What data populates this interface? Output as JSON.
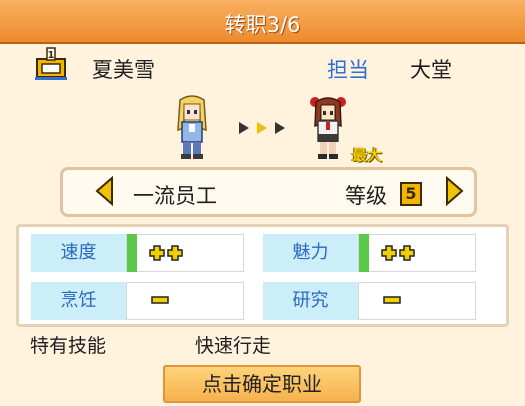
{
  "title": "转职3/6",
  "employee": {
    "name": "夏美雪",
    "rank_icon": "rank-1-icon",
    "role_label": "担当",
    "department": "大堂"
  },
  "transition": {
    "from_sprite": "blonde-employee-sprite",
    "to_sprite": "red-haired-employee-sprite",
    "arrow_icon": "triple-arrow-icon",
    "max_badge": "最大"
  },
  "job": {
    "name": "一流员工",
    "level_label": "等级",
    "level": "5"
  },
  "stats": [
    {
      "label": "速度",
      "value_icons": "double-plus",
      "has_bar": true
    },
    {
      "label": "魅力",
      "value_icons": "double-plus",
      "has_bar": true
    },
    {
      "label": "烹饪",
      "value_icons": "minus",
      "has_bar": false
    },
    {
      "label": "研究",
      "value_icons": "minus",
      "has_bar": false
    }
  ],
  "skill": {
    "label": "特有技能",
    "value": "快速行走"
  },
  "confirm_button": "点击确定职业",
  "colors": {
    "title_bar": "#ee8a2e",
    "background": "#fff3de",
    "accent_blue": "#2f6fd6",
    "stat_label_bg": "#cceef8",
    "stat_bar": "#5cc84a",
    "button": "#f6b24e"
  }
}
